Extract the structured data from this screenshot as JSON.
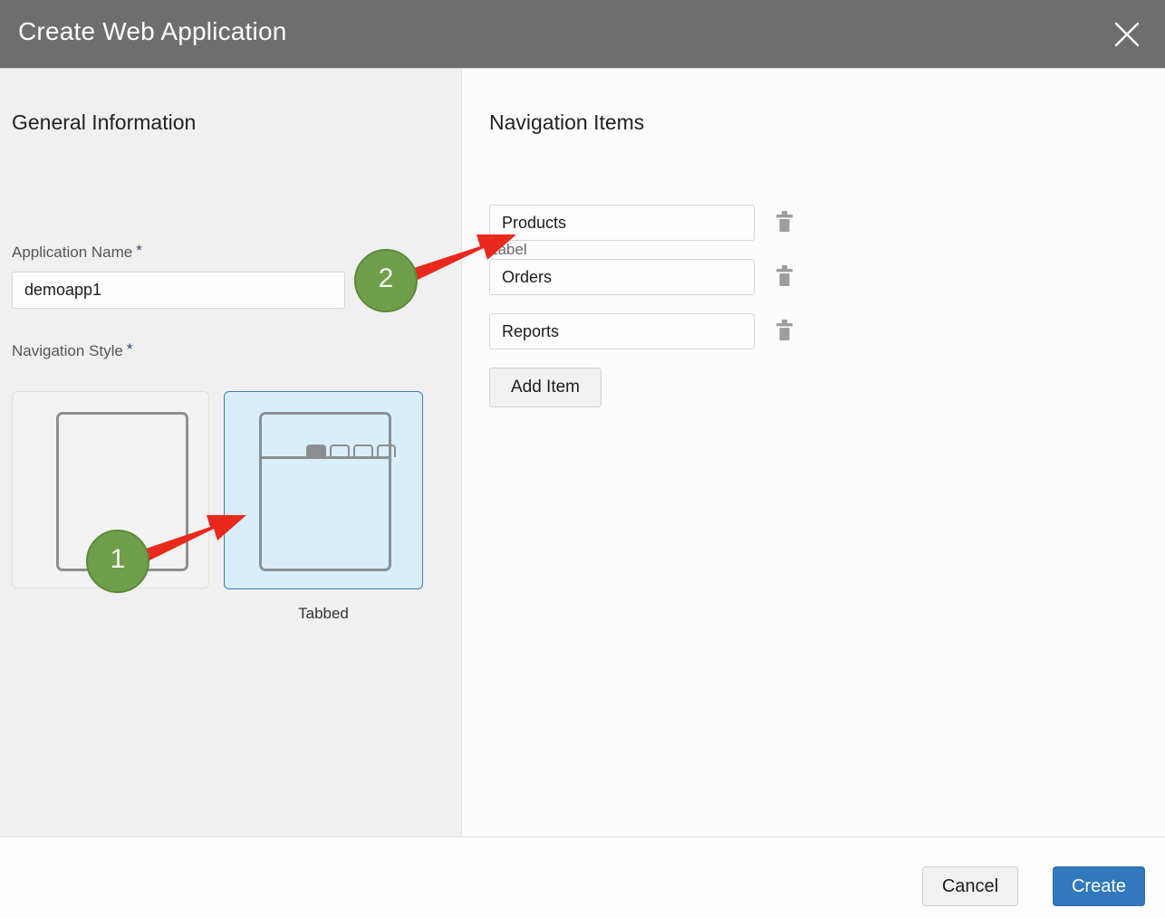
{
  "dialog": {
    "title": "Create Web Application",
    "close_icon": "close-icon"
  },
  "left_panel": {
    "section_title": "General Information",
    "application_name": {
      "label": "Application Name",
      "required_marker": "*",
      "value": "demoapp1",
      "placeholder": ""
    },
    "navigation_style": {
      "label": "Navigation Style",
      "required_marker": "*",
      "options": [
        {
          "id": "standard",
          "caption": "",
          "selected": false
        },
        {
          "id": "tabbed",
          "caption": "Tabbed",
          "selected": true
        }
      ]
    }
  },
  "right_panel": {
    "section_title": "Navigation Items",
    "column_header": "Label",
    "items": [
      {
        "value": "Products",
        "delete_icon": "trash-icon"
      },
      {
        "value": "Orders",
        "delete_icon": "trash-icon"
      },
      {
        "value": "Reports",
        "delete_icon": "trash-icon"
      }
    ],
    "add_item_label": "Add Item"
  },
  "footer": {
    "cancel_label": "Cancel",
    "create_label": "Create"
  },
  "annotations": [
    {
      "number": "1",
      "target": "tabbed navigation style card"
    },
    {
      "number": "2",
      "target": "first navigation item label input"
    }
  ],
  "colors": {
    "header_bg": "#6e6e6e",
    "left_panel_bg": "#f0f0f0",
    "right_panel_bg": "#fcfcfc",
    "selected_card_bg": "#d9eefb",
    "selected_card_border": "#3b7dbf",
    "primary_button_bg": "#3179bd",
    "required_marker": "#2b4a72",
    "annotation_badge": "#6f9f4a",
    "annotation_arrow": "#e8291c"
  }
}
